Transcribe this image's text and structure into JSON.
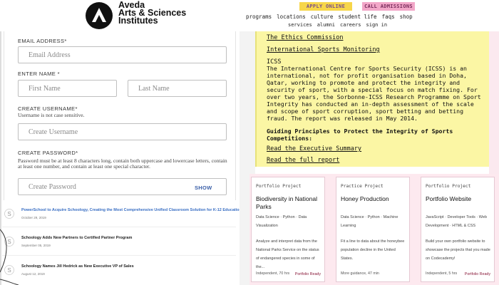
{
  "header": {
    "logo_line1": "Aveda",
    "logo_line2": "Arts & Sciences",
    "logo_line3": "Institutes",
    "apply_label": "APPLY ONLINE",
    "call_label": "CALL ADMISSIONS",
    "nav_primary": [
      "programs",
      "locations",
      "culture",
      "student life",
      "faqs",
      "shop"
    ],
    "nav_secondary": [
      "services",
      "alumni",
      "careers",
      "sign in"
    ]
  },
  "form": {
    "email_label": "EMAIL ADDRESS*",
    "email_placeholder": "Email Address",
    "name_label": "ENTER NAME *",
    "first_placeholder": "First Name",
    "last_placeholder": "Last Name",
    "username_label": "CREATE USERNAME*",
    "username_help": "Username is not case sensitive.",
    "username_placeholder": "Create Username",
    "password_label": "CREATE PASSWORD*",
    "password_help": "Password must be at least 8 characters long, contain both uppercase and lowercase letters, contain at least one number, and contain at least one special character.",
    "password_placeholder": "Create Password",
    "show_label": "SHOW"
  },
  "news": [
    {
      "title": "PowerSchool to Acquire Schoology, Creating the Most Comprehensive Unified Classroom Solution for K-12 Education",
      "date": "October 29, 2019",
      "color": "#3a6fc4"
    },
    {
      "title": "Schoology Adds New Partners to Certified Partner Program",
      "date": "September 05, 2019",
      "color": "#222222"
    },
    {
      "title": "Schoology Names Jill Hedrick as New Executive VP of Sales",
      "date": "August 12, 2019",
      "color": "#222222"
    }
  ],
  "article": {
    "link1": "The Ethics Commission",
    "link2": "International Sports Monitoring",
    "heading": "ICSS",
    "body": "The International Centre for Sports Security (ICSS) is an international, not for profit organisation based in Doha, Qatar, working to promote and protect the integrity and security of sport, with a special focus on match fixing. For over two years, the Sorbonne-ICSS Research Programme on Sport Integrity has conducted an in-depth assessment of the scale and scope of sport corruption, sport betting and betting fraud. The report was released in May 2014.",
    "principles": "Guiding Principles to Protect the Integrity of Sports Competitions:",
    "link3": "Read the Executive Summary",
    "link4": "Read the full report"
  },
  "cards": [
    {
      "kicker": "Portfolio Project",
      "title": "Biodiversity in National Parks",
      "tags": "Data Science · Python · Data Visualization",
      "desc": "Analyze and interpret data from the National Parks Service on the status of endangered species in some of the...",
      "foot": "Independent, 70 hrs",
      "badge": "Portfolio Ready"
    },
    {
      "kicker": "Practice Project",
      "title": "Honey Production",
      "tags": "Data Science · Python · Machine Learning",
      "desc": "Fit a line to data about the honeybee population decline in the United States.",
      "foot": "More guidance, 47 min",
      "badge": ""
    },
    {
      "kicker": "Portfolio Project",
      "title": "Portfolio Website",
      "tags": "JavaScript · Developer Tools · Web Development · HTML & CSS",
      "desc": "Build your own portfolio website to showcase the projects that you made on Codecademy!",
      "foot": "Independent, 5 hrs",
      "badge": "Portfolio Ready"
    }
  ]
}
